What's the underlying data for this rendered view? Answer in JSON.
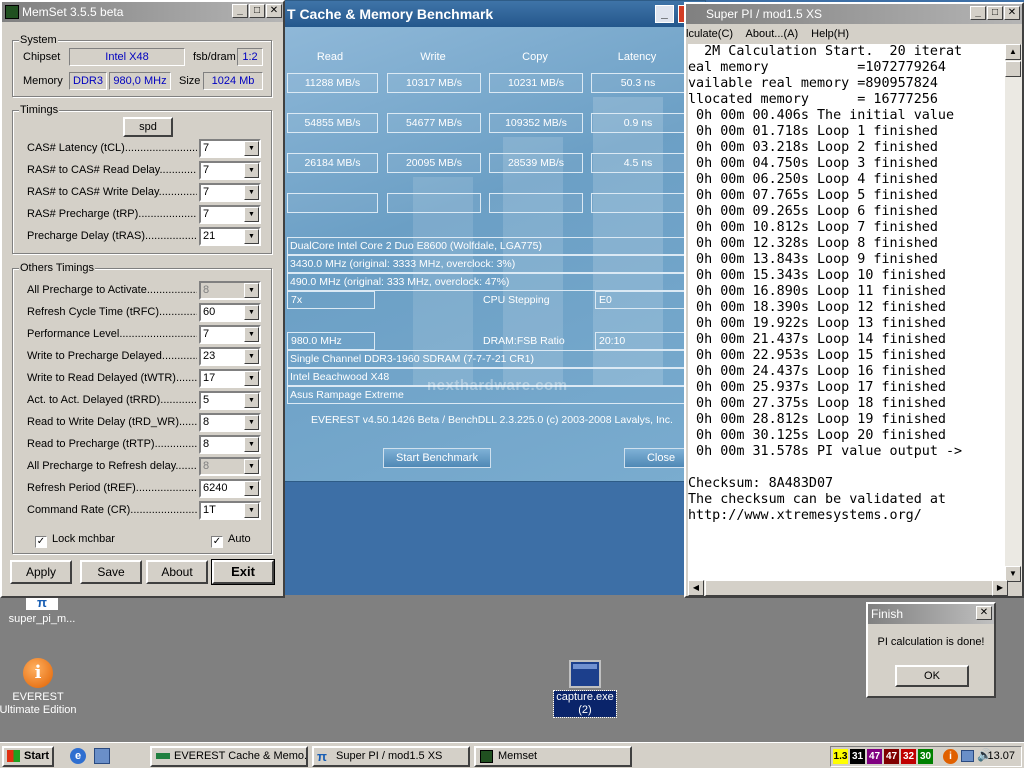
{
  "desktop": {
    "icons": [
      {
        "label": "super_pi_m...",
        "selected": false
      },
      {
        "label": "EVEREST\nUltimate Edition",
        "selected": false
      },
      {
        "label": "capture.exe\n(2)",
        "selected": true
      }
    ]
  },
  "memset": {
    "title": "MemSet 3.5.5 beta",
    "system": {
      "group_label": "System",
      "chipset_label": "Chipset",
      "chipset_value": "Intel X48",
      "fsb_label": "fsb/dram",
      "fsb_value": "1:2",
      "memory_label": "Memory",
      "memory_type": "DDR3",
      "memory_freq": "980,0 MHz",
      "size_label": "Size",
      "size_value": "1024 Mb"
    },
    "timings": {
      "group_label": "Timings",
      "spd_button": "spd",
      "rows": [
        {
          "label": "CAS# Latency (tCL)...........................",
          "value": "7"
        },
        {
          "label": "RAS# to CAS# Read Delay..............",
          "value": "7"
        },
        {
          "label": "RAS# to CAS# Write Delay.............",
          "value": "7"
        },
        {
          "label": "RAS# Precharge (tRP).....................",
          "value": "7"
        },
        {
          "label": "Precharge Delay  (tRAS)....................",
          "value": "21"
        }
      ]
    },
    "others": {
      "group_label": "Others Timings",
      "rows": [
        {
          "label": "All Precharge to Activate......................",
          "value": "8",
          "disabled": true
        },
        {
          "label": "Refresh Cycle Time (tRFC)..................",
          "value": "60",
          "disabled": false
        },
        {
          "label": "Performance Level...................................",
          "value": "7",
          "disabled": false
        },
        {
          "label": "Write to Precharge Delayed..............",
          "value": "23",
          "disabled": false
        },
        {
          "label": "Write to Read Delayed (tWTR)...........",
          "value": "17",
          "disabled": false
        },
        {
          "label": "Act. to Act. Delayed (tRRD)..............",
          "value": "5",
          "disabled": false
        },
        {
          "label": "Read to Write Delay (tRD_WR).........",
          "value": "8",
          "disabled": false
        },
        {
          "label": "Read to Precharge (tRTP)...................",
          "value": "8",
          "disabled": false
        },
        {
          "label": "All Precharge to Refresh delay...........",
          "value": "8",
          "disabled": true
        },
        {
          "label": "Refresh Period (tREF)........................",
          "value": "6240",
          "disabled": false
        },
        {
          "label": "Command Rate (CR)...........................",
          "value": "1T",
          "disabled": false
        }
      ],
      "lock_label": "Lock mchbar",
      "auto_label": "Auto"
    },
    "buttons": {
      "apply": "Apply",
      "save": "Save",
      "about": "About",
      "exit": "Exit"
    }
  },
  "everest": {
    "title": "T Cache & Memory Benchmark",
    "columns": [
      "Read",
      "Write",
      "Copy",
      "Latency"
    ],
    "rows": [
      [
        "11288 MB/s",
        "10317 MB/s",
        "10231 MB/s",
        "50.3 ns"
      ],
      [
        "54855 MB/s",
        "54677 MB/s",
        "109352 MB/s",
        "0.9 ns"
      ],
      [
        "26184 MB/s",
        "20095 MB/s",
        "28539 MB/s",
        "4.5 ns"
      ],
      [
        "",
        "",
        "",
        ""
      ]
    ],
    "cpu_line": "DualCore Intel Core 2 Duo E8600  (Wolfdale, LGA775)",
    "clock_line": "3430.0 MHz  (original: 3333 MHz, overclock: 3%)",
    "fsb_line": "490.0 MHz  (original: 333 MHz, overclock: 47%)",
    "multiplier": "7x",
    "cpu_stepping_label": "CPU Stepping",
    "cpu_stepping": "E0",
    "mem_clock": "980.0 MHz",
    "dram_fsb_label": "DRAM:FSB Ratio",
    "dram_fsb": "20:10",
    "memory_type": "Single Channel DDR3-1960 SDRAM  (7-7-7-21 CR1)",
    "chipset": "Intel Beachwood X48",
    "motherboard": "Asus Rampage Extreme",
    "watermark": "nexthardware.com",
    "footer": "EVEREST v4.50.1426 Beta / BenchDLL 2.3.225.0  (c) 2003-2008 Lavalys, Inc.",
    "start_button": "Start Benchmark",
    "close_button": "Close"
  },
  "superpi": {
    "title": "Super PI / mod1.5 XS",
    "menu": [
      "lculate(C)",
      "About...(A)",
      "Help(H)"
    ],
    "lines": [
      "  2M Calculation Start.  20 iterat",
      "eal memory           =1072779264",
      "vailable real memory =890957824",
      "llocated memory      = 16777256",
      " 0h 00m 00.406s The initial value",
      " 0h 00m 01.718s Loop 1 finished",
      " 0h 00m 03.218s Loop 2 finished",
      " 0h 00m 04.750s Loop 3 finished",
      " 0h 00m 06.250s Loop 4 finished",
      " 0h 00m 07.765s Loop 5 finished",
      " 0h 00m 09.265s Loop 6 finished",
      " 0h 00m 10.812s Loop 7 finished",
      " 0h 00m 12.328s Loop 8 finished",
      " 0h 00m 13.843s Loop 9 finished",
      " 0h 00m 15.343s Loop 10 finished",
      " 0h 00m 16.890s Loop 11 finished",
      " 0h 00m 18.390s Loop 12 finished",
      " 0h 00m 19.922s Loop 13 finished",
      " 0h 00m 21.437s Loop 14 finished",
      " 0h 00m 22.953s Loop 15 finished",
      " 0h 00m 24.437s Loop 16 finished",
      " 0h 00m 25.937s Loop 17 finished",
      " 0h 00m 27.375s Loop 18 finished",
      " 0h 00m 28.812s Loop 19 finished",
      " 0h 00m 30.125s Loop 20 finished",
      " 0h 00m 31.578s PI value output ->",
      "",
      "Checksum: 8A483D07",
      "The checksum can be validated at",
      "http://www.xtremesystems.org/"
    ]
  },
  "finish_dialog": {
    "title": "Finish",
    "message": "PI calculation is done!",
    "ok_button": "OK"
  },
  "taskbar": {
    "start": "Start",
    "tasks": [
      "EVEREST Cache & Memo...",
      "Super PI / mod1.5 XS",
      "Memset"
    ],
    "tray_values": [
      {
        "text": "1.3",
        "bg": "#ffff00",
        "fg": "#000000"
      },
      {
        "text": "31",
        "bg": "#000000",
        "fg": "#ffffff"
      },
      {
        "text": "47",
        "bg": "#800080",
        "fg": "#ffffff"
      },
      {
        "text": "47",
        "bg": "#800000",
        "fg": "#ffffff"
      },
      {
        "text": "32",
        "bg": "#c00000",
        "fg": "#ffffff"
      },
      {
        "text": "30",
        "bg": "#008000",
        "fg": "#ffffff"
      }
    ],
    "clock": "13.07"
  }
}
